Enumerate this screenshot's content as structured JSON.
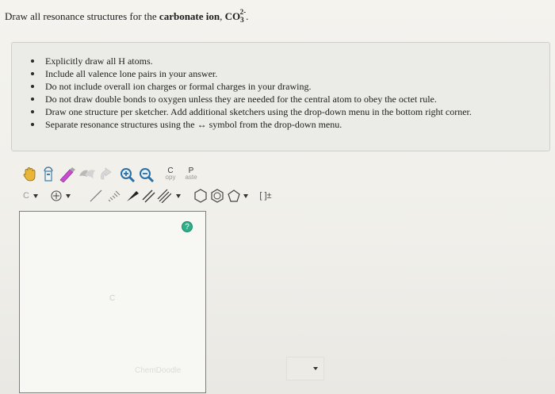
{
  "question": {
    "prefix": "Draw all resonance structures for the",
    "bold": "carbonate ion",
    "sep": ",",
    "formula_base": "CO",
    "formula_sub": "3",
    "formula_sup": "2-",
    "period": "."
  },
  "instructions": [
    "Explicitly draw all H atoms.",
    "Include all valence lone pairs in your answer.",
    "Do not include overall ion charges or formal charges in your drawing.",
    "Do not draw double bonds to oxygen unless they are needed for the central atom to obey the octet rule.",
    "Draw one structure per sketcher. Add additional sketchers using the drop-down menu in the bottom right corner.",
    "Separate resonance structures using the ↔ symbol from the drop-down menu."
  ],
  "toolbar": {
    "copy_letter": "C",
    "copy_label": "opy",
    "paste_letter": "P",
    "paste_label": "aste",
    "atom_label": "C",
    "charge_label": "[ ]±"
  },
  "canvas": {
    "center_label": "C",
    "help_label": "?",
    "bottom_button_label": "ChemDoodle"
  },
  "colors": {
    "accent": "#2fae8a",
    "panel": "#ebebe7",
    "background": "#f0efea"
  }
}
